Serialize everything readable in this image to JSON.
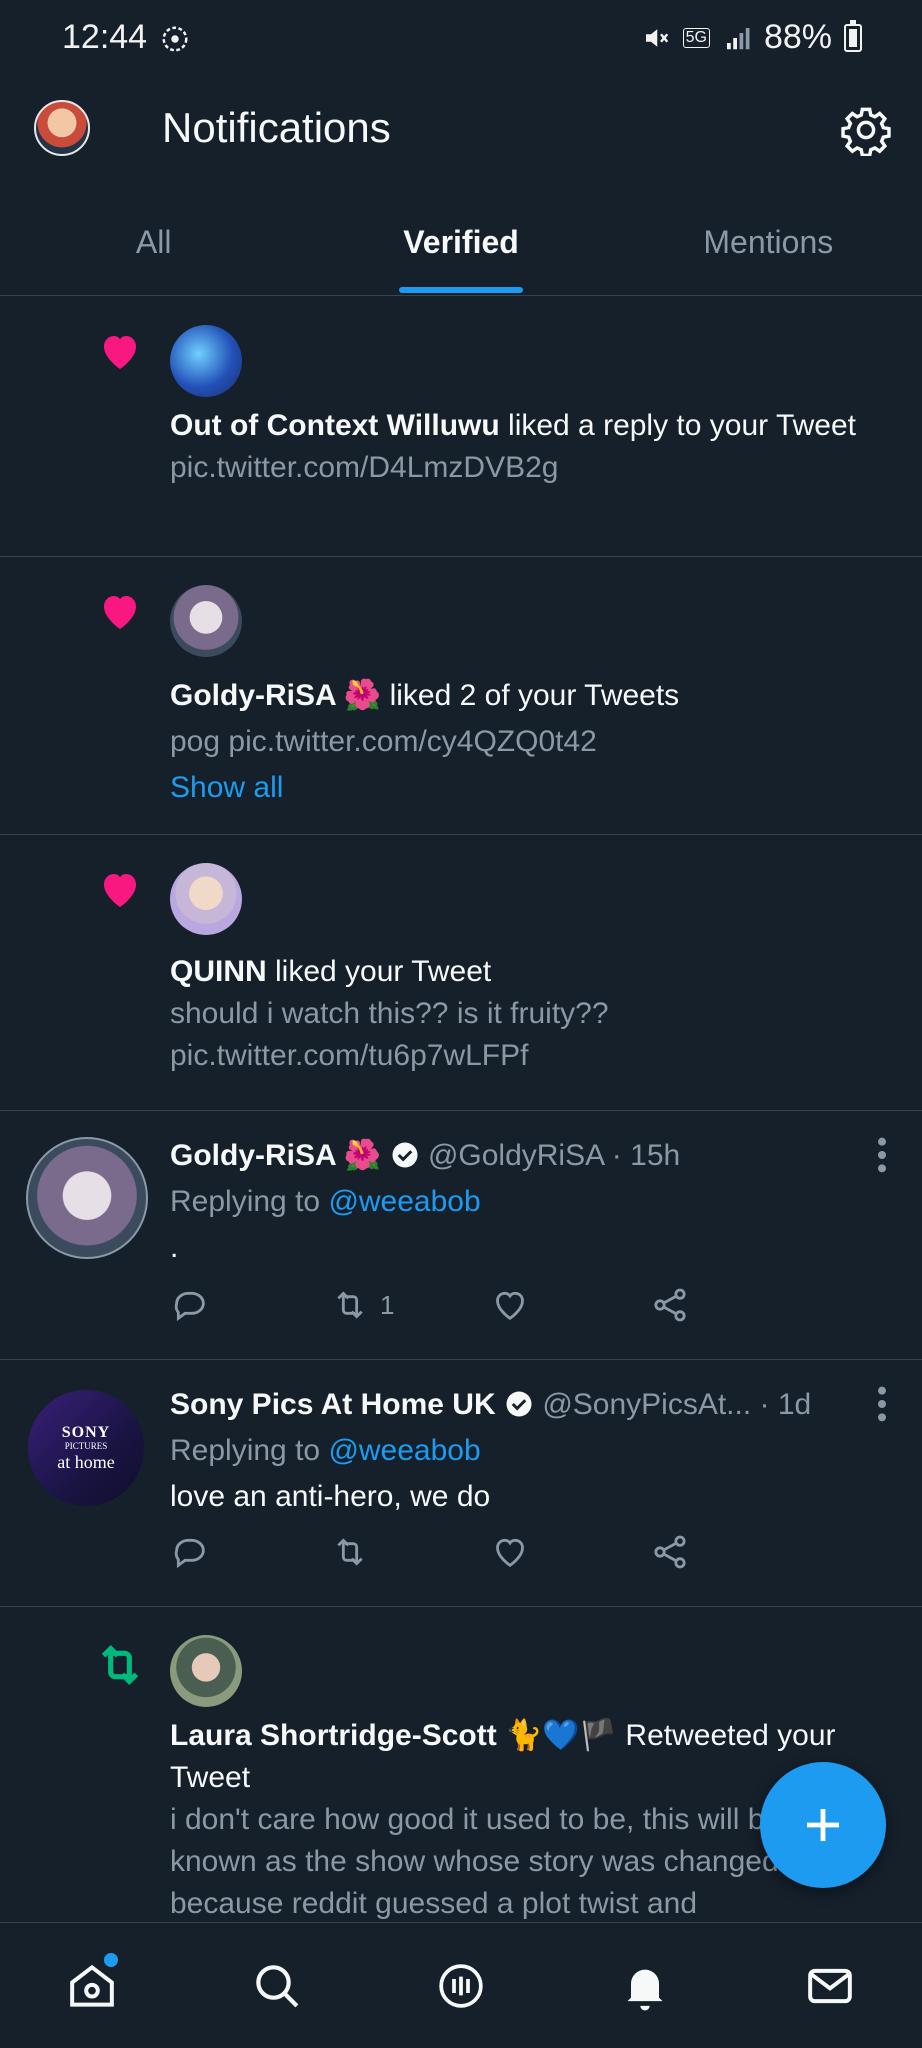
{
  "status_bar": {
    "time": "12:44",
    "battery": "88%",
    "network": "5G"
  },
  "header": {
    "title": "Notifications"
  },
  "tabs": [
    {
      "label": "All"
    },
    {
      "label": "Verified"
    },
    {
      "label": "Mentions"
    }
  ],
  "notifications": [
    {
      "name": "Out of Context Willuwu",
      "action": " liked a reply to your Tweet",
      "preview": " pic.twitter.com/D4LmzDVB2g"
    },
    {
      "name": "Goldy-RiSA 🌺",
      "action": " liked 2 of your Tweets",
      "preview": "pog pic.twitter.com/cy4QZQ0t42",
      "show_all": "Show all"
    },
    {
      "name": "QUINN",
      "action": " liked your Tweet",
      "preview": "should i watch this?? is it fruity?? pic.twitter.com/tu6p7wLFPf"
    }
  ],
  "tweets": [
    {
      "name": "Goldy-RiSA 🌺",
      "handle": "@GoldyRiSA",
      "time": " · 15h",
      "replying_label": "Replying to ",
      "replying_to": "@weeabob",
      "text": ".",
      "retweets": "1"
    },
    {
      "name": "Sony Pics At Home UK",
      "handle": "@SonyPicsAt...",
      "time": " · 1d",
      "replying_label": "Replying to ",
      "replying_to": "@weeabob",
      "text": "love an anti-hero, we do",
      "avatar_text_1": "SONY",
      "avatar_text_2": "PICTURES",
      "avatar_text_3": "at home"
    }
  ],
  "retweet_notification": {
    "name": "Laura Shortridge-Scott 🐈💙🏴",
    "action": " Retweeted your Tweet",
    "preview": "i don't care how good it used to be, this will be forever known as the show whose story was changed because reddit guessed a plot twist and"
  },
  "colors": {
    "background": "#15202b",
    "accent": "#1d9bf0",
    "like": "#f91880",
    "retweet": "#00ba7c",
    "muted": "#8b98a5"
  }
}
